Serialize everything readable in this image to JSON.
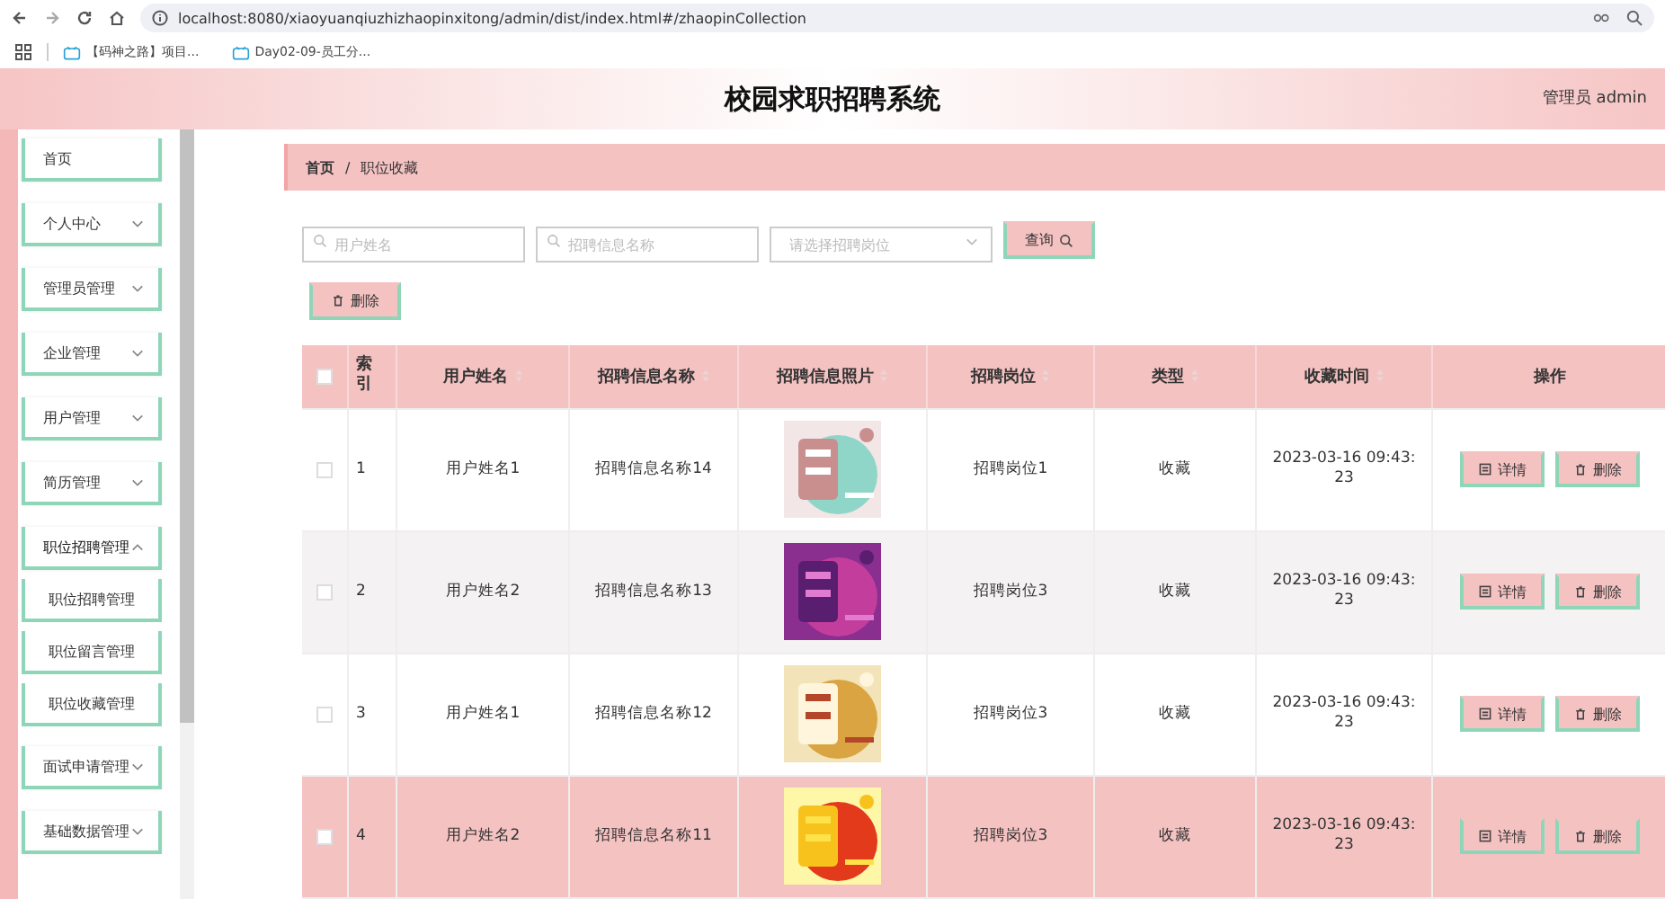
{
  "browser": {
    "url": "localhost:8080/xiaoyuanqiuzhizhaopinxitong/admin/dist/index.html#/zhaopinCollection",
    "bookmarks": [
      "【码神之路】项目...",
      "Day02-09-员工分..."
    ]
  },
  "header": {
    "title": "校园求职招聘系统",
    "user": "管理员 admin"
  },
  "sidebar": {
    "items": [
      {
        "label": "首页",
        "expandable": false
      },
      {
        "label": "个人中心",
        "expandable": true,
        "expanded": false
      },
      {
        "label": "管理员管理",
        "expandable": true,
        "expanded": false
      },
      {
        "label": "企业管理",
        "expandable": true,
        "expanded": false
      },
      {
        "label": "用户管理",
        "expandable": true,
        "expanded": false
      },
      {
        "label": "简历管理",
        "expandable": true,
        "expanded": false
      },
      {
        "label": "职位招聘管理",
        "expandable": true,
        "expanded": true,
        "children": [
          {
            "label": "职位招聘管理"
          },
          {
            "label": "职位留言管理"
          },
          {
            "label": "职位收藏管理"
          }
        ]
      },
      {
        "label": "面试申请管理",
        "expandable": true,
        "expanded": false
      },
      {
        "label": "基础数据管理",
        "expandable": true,
        "expanded": false
      }
    ]
  },
  "breadcrumb": {
    "items": [
      "首页",
      "职位收藏"
    ],
    "separator": "/"
  },
  "filters": {
    "fields": [
      {
        "kind": "input",
        "placeholder": "用户姓名"
      },
      {
        "kind": "input",
        "placeholder": "招聘信息名称"
      },
      {
        "kind": "select",
        "placeholder": "请选择招聘岗位"
      }
    ],
    "search_button": "查询"
  },
  "delete_button": "删除",
  "table": {
    "header_checked": false,
    "columns": [
      {
        "label": "索引",
        "kind": "plain"
      },
      {
        "label": "用户姓名",
        "kind": "sortable"
      },
      {
        "label": "招聘信息名称",
        "kind": "sortable"
      },
      {
        "label": "招聘信息照片",
        "kind": "sortable"
      },
      {
        "label": "招聘岗位",
        "kind": "sortable"
      },
      {
        "label": "类型",
        "kind": "sortable"
      },
      {
        "label": "收藏时间",
        "kind": "sortable"
      },
      {
        "label": "操作",
        "kind": "plain"
      }
    ],
    "rows": [
      {
        "checked": false,
        "highlighted": false,
        "index": "1",
        "user": "用户姓名1",
        "name": "招聘信息名称14",
        "photo": {
          "kind": "picture"
        },
        "position": "招聘岗位1",
        "type": "收藏",
        "time": "2023-03-16 09:43:23",
        "actions": [
          "详情",
          "删除"
        ]
      },
      {
        "checked": false,
        "highlighted": false,
        "index": "2",
        "user": "用户姓名2",
        "name": "招聘信息名称13",
        "photo": {
          "kind": "picture"
        },
        "position": "招聘岗位3",
        "type": "收藏",
        "time": "2023-03-16 09:43:23",
        "actions": [
          "详情",
          "删除"
        ]
      },
      {
        "checked": false,
        "highlighted": false,
        "index": "3",
        "user": "用户姓名1",
        "name": "招聘信息名称12",
        "photo": {
          "kind": "picture"
        },
        "position": "招聘岗位3",
        "type": "收藏",
        "time": "2023-03-16 09:43:23",
        "actions": [
          "详情",
          "删除"
        ]
      },
      {
        "checked": false,
        "highlighted": true,
        "index": "4",
        "user": "用户姓名2",
        "name": "招聘信息名称11",
        "photo": {
          "kind": "picture"
        },
        "position": "招聘岗位3",
        "type": "收藏",
        "time": "2023-03-16 09:43:23",
        "actions": [
          "详情",
          "删除"
        ]
      }
    ]
  }
}
